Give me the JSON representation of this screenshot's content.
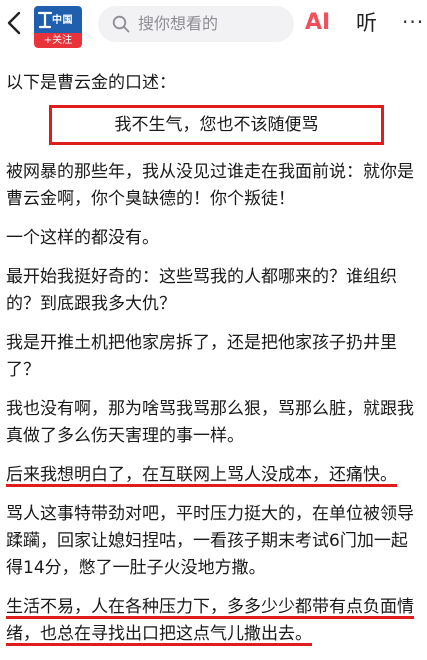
{
  "topbar": {
    "avatar_logo_text": "中国",
    "follow_label": "+关注",
    "search_placeholder": "搜你想看的",
    "ai_label": "AI",
    "listen_label": "听",
    "more_label": "···"
  },
  "article": {
    "intro": "以下是曹云金的口述：",
    "quote": "我不生气，您也不该随便骂",
    "paragraphs": [
      "被网暴的那些年，我从没见过谁走在我面前说：就你是曹云金啊，你个臭缺德的！你个叛徒！",
      "一个这样的都没有。",
      "最开始我挺好奇的：这些骂我的人都哪来的？谁组织的？到底跟我多大仇？",
      "我是开推土机把他家房拆了，还是把他家孩子扔井里了？",
      "我也没有啊，那为啥骂我骂那么狠，骂那么脏，就跟我真做了多么伤天害理的事一样。",
      "后来我想明白了，在互联网上骂人没成本，还痛快。",
      "骂人这事特带劲对吧，平时压力挺大的，在单位被领导蹂躏，回家让媳妇捏咕，一看孩子期末考试6门加一起得14分，憋了一肚子火没地方撒。",
      "生活不易，人在各种压力下，多多少少都带有点负面情绪，也总在寻找出口把这点气儿撒出去。"
    ]
  },
  "colors": {
    "highlight_red": "#e01c1c",
    "follow_red": "#e8333a",
    "ai_red": "#f0505a",
    "logo_blue": "#1f5fae"
  }
}
